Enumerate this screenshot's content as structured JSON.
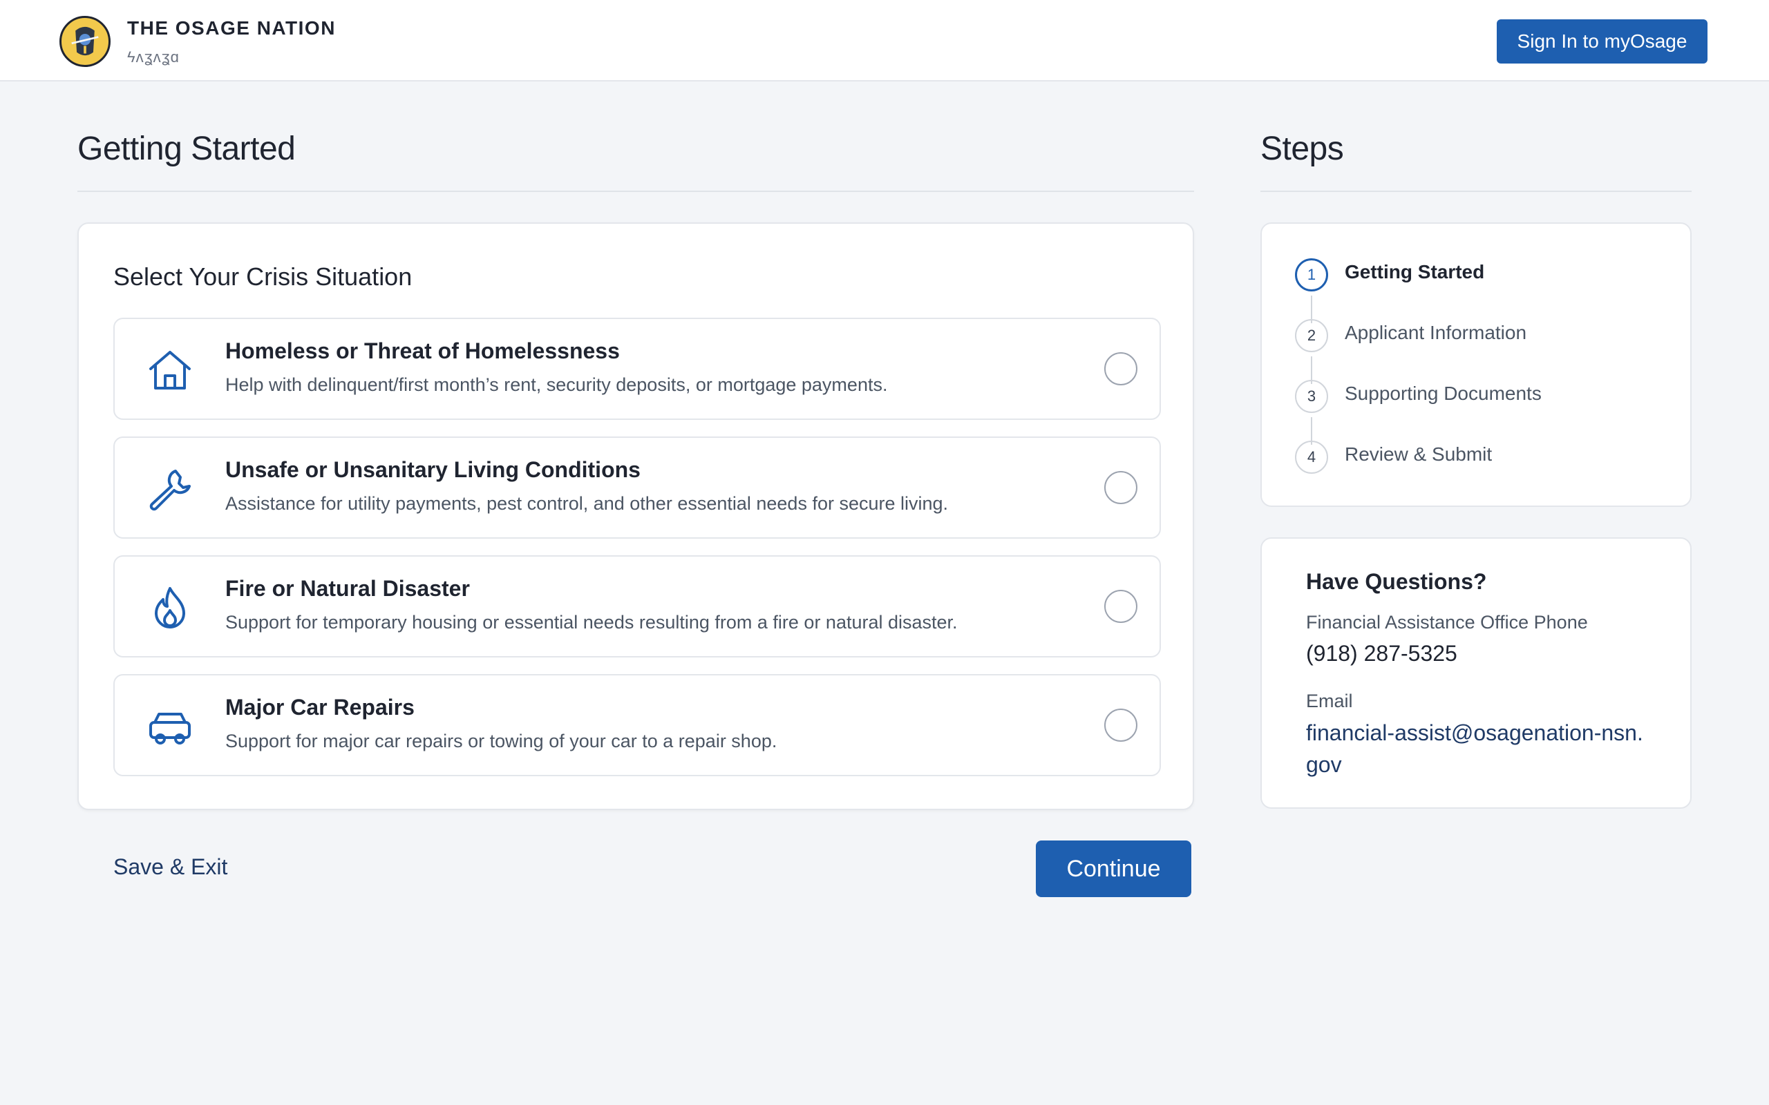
{
  "header": {
    "brand_title": "THE OSAGE NATION",
    "brand_subtitle": "ϟʌʓʌʓɑ",
    "signin_label": "Sign In to myOsage",
    "logo_icon": "osage-seal-icon"
  },
  "main": {
    "title": "Getting Started",
    "card_title": "Select Your Crisis Situation",
    "options": [
      {
        "icon": "house-icon",
        "title": "Homeless or Threat of Homelessness",
        "description": "Help with delinquent/first month’s rent, security deposits, or mortgage payments."
      },
      {
        "icon": "wrench-icon",
        "title": "Unsafe or Unsanitary Living Conditions",
        "description": "Assistance for utility payments, pest control, and other essential needs for secure living."
      },
      {
        "icon": "flame-icon",
        "title": "Fire or Natural Disaster",
        "description": "Support for temporary housing or essential needs resulting from a fire or natural disaster."
      },
      {
        "icon": "car-icon",
        "title": "Major Car Repairs",
        "description": "Support for major car repairs or towing of your car to a repair shop."
      }
    ],
    "save_exit_label": "Save & Exit",
    "continue_label": "Continue"
  },
  "steps": {
    "title": "Steps",
    "items": [
      {
        "number": "1",
        "label": "Getting Started",
        "active": true
      },
      {
        "number": "2",
        "label": "Applicant Information",
        "active": false
      },
      {
        "number": "3",
        "label": "Supporting Documents",
        "active": false
      },
      {
        "number": "4",
        "label": "Review & Submit",
        "active": false
      }
    ]
  },
  "questions": {
    "title": "Have Questions?",
    "phone_label": "Financial Assistance Office Phone",
    "phone": "(918) 287-5325",
    "email_label": "Email",
    "email": "financial-assist@osagenation-nsn.gov"
  },
  "colors": {
    "primary": "#1e5fb0",
    "background": "#f3f5f8",
    "logo_gold": "#f2c94c"
  }
}
